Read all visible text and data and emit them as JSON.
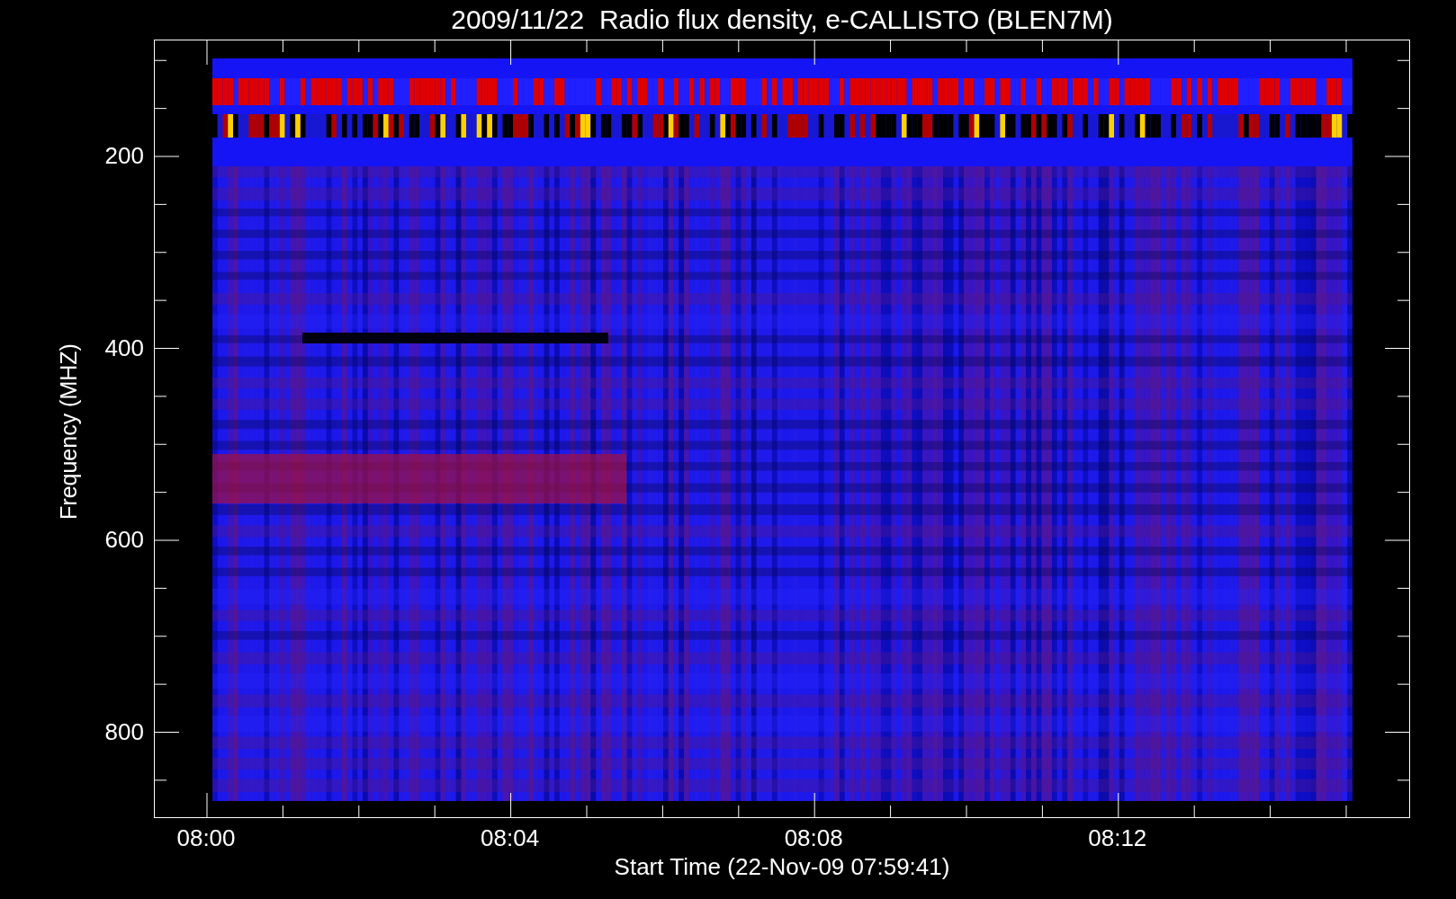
{
  "title": "2009/11/22  Radio flux density, e-CALLISTO (BLEN7M)",
  "y_axis": {
    "label": "Frequency (MHZ)",
    "ticks": [
      "200",
      "400",
      "600",
      "800"
    ]
  },
  "x_axis": {
    "label": "Start Time (22-Nov-09 07:59:41)",
    "ticks": [
      "08:00",
      "08:04",
      "08:08",
      "08:12"
    ]
  }
}
